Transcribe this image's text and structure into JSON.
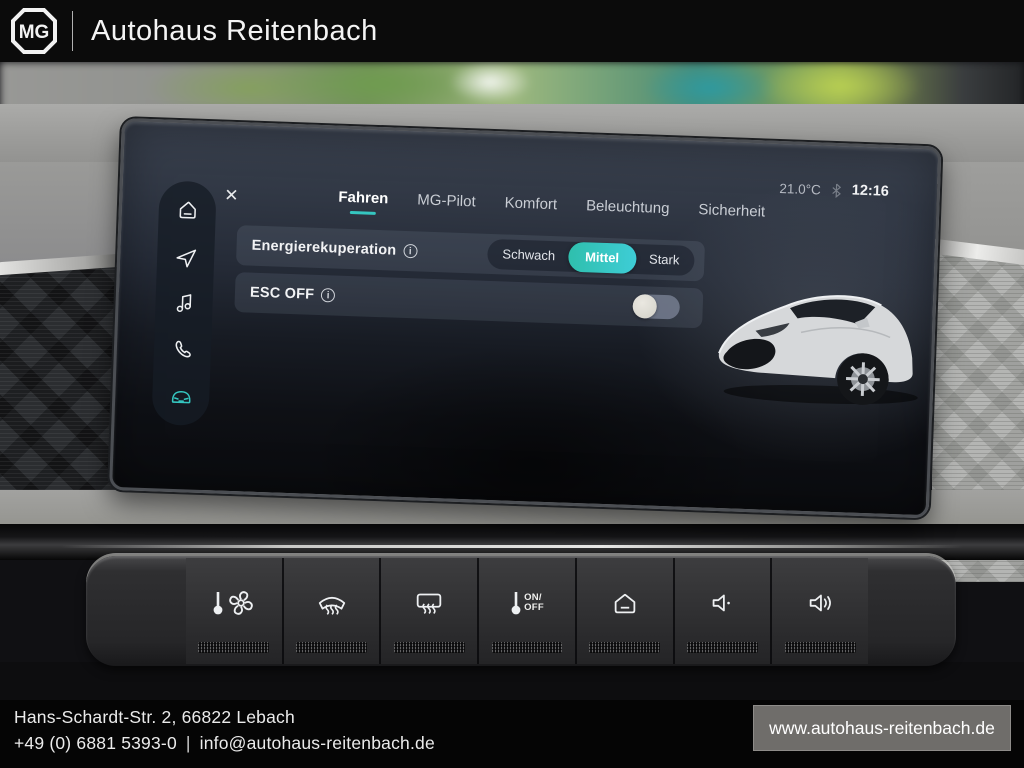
{
  "header": {
    "brand": "MG",
    "dealer_name": "Autohaus Reitenbach"
  },
  "infotainment": {
    "status": {
      "temperature": "21.0°C",
      "time": "12:16",
      "bluetooth_icon": "bluetooth-icon"
    },
    "close_label": "✕",
    "tabs": [
      {
        "label": "Fahren",
        "active": true
      },
      {
        "label": "MG-Pilot",
        "active": false
      },
      {
        "label": "Komfort",
        "active": false
      },
      {
        "label": "Beleuchtung",
        "active": false
      },
      {
        "label": "Sicherheit",
        "active": false
      }
    ],
    "sidebar": [
      {
        "icon": "home-icon"
      },
      {
        "icon": "navigation-icon"
      },
      {
        "icon": "music-icon"
      },
      {
        "icon": "phone-icon"
      },
      {
        "icon": "vehicle-icon",
        "active": true
      }
    ],
    "settings": {
      "energy": {
        "label": "Energierekuperation",
        "options": [
          "Schwach",
          "Mittel",
          "Stark"
        ],
        "selected": "Mittel"
      },
      "esc": {
        "label": "ESC OFF",
        "state": "off"
      }
    },
    "colors": {
      "accent": "#35c6c0",
      "selected_start": "#2fbfad",
      "selected_end": "#3ecdd6",
      "toggle_knob": "#ece9df"
    }
  },
  "hard_buttons": {
    "items": [
      {
        "icon": "climate-fan-icon"
      },
      {
        "icon": "front-defrost-icon"
      },
      {
        "icon": "rear-defrost-icon"
      },
      {
        "icon": "temp-on-off-icon",
        "text_line1": "ON/",
        "text_line2": "OFF"
      },
      {
        "icon": "home-hardkey-icon"
      },
      {
        "icon": "volume-down-icon"
      },
      {
        "icon": "volume-up-icon"
      }
    ]
  },
  "footer": {
    "address": "Hans-Schardt-Str. 2, 66822 Lebach",
    "phone": "+49 (0) 6881 5393-0",
    "separator": "|",
    "email": "info@autohaus-reitenbach.de",
    "website": "www.autohaus-reitenbach.de"
  }
}
